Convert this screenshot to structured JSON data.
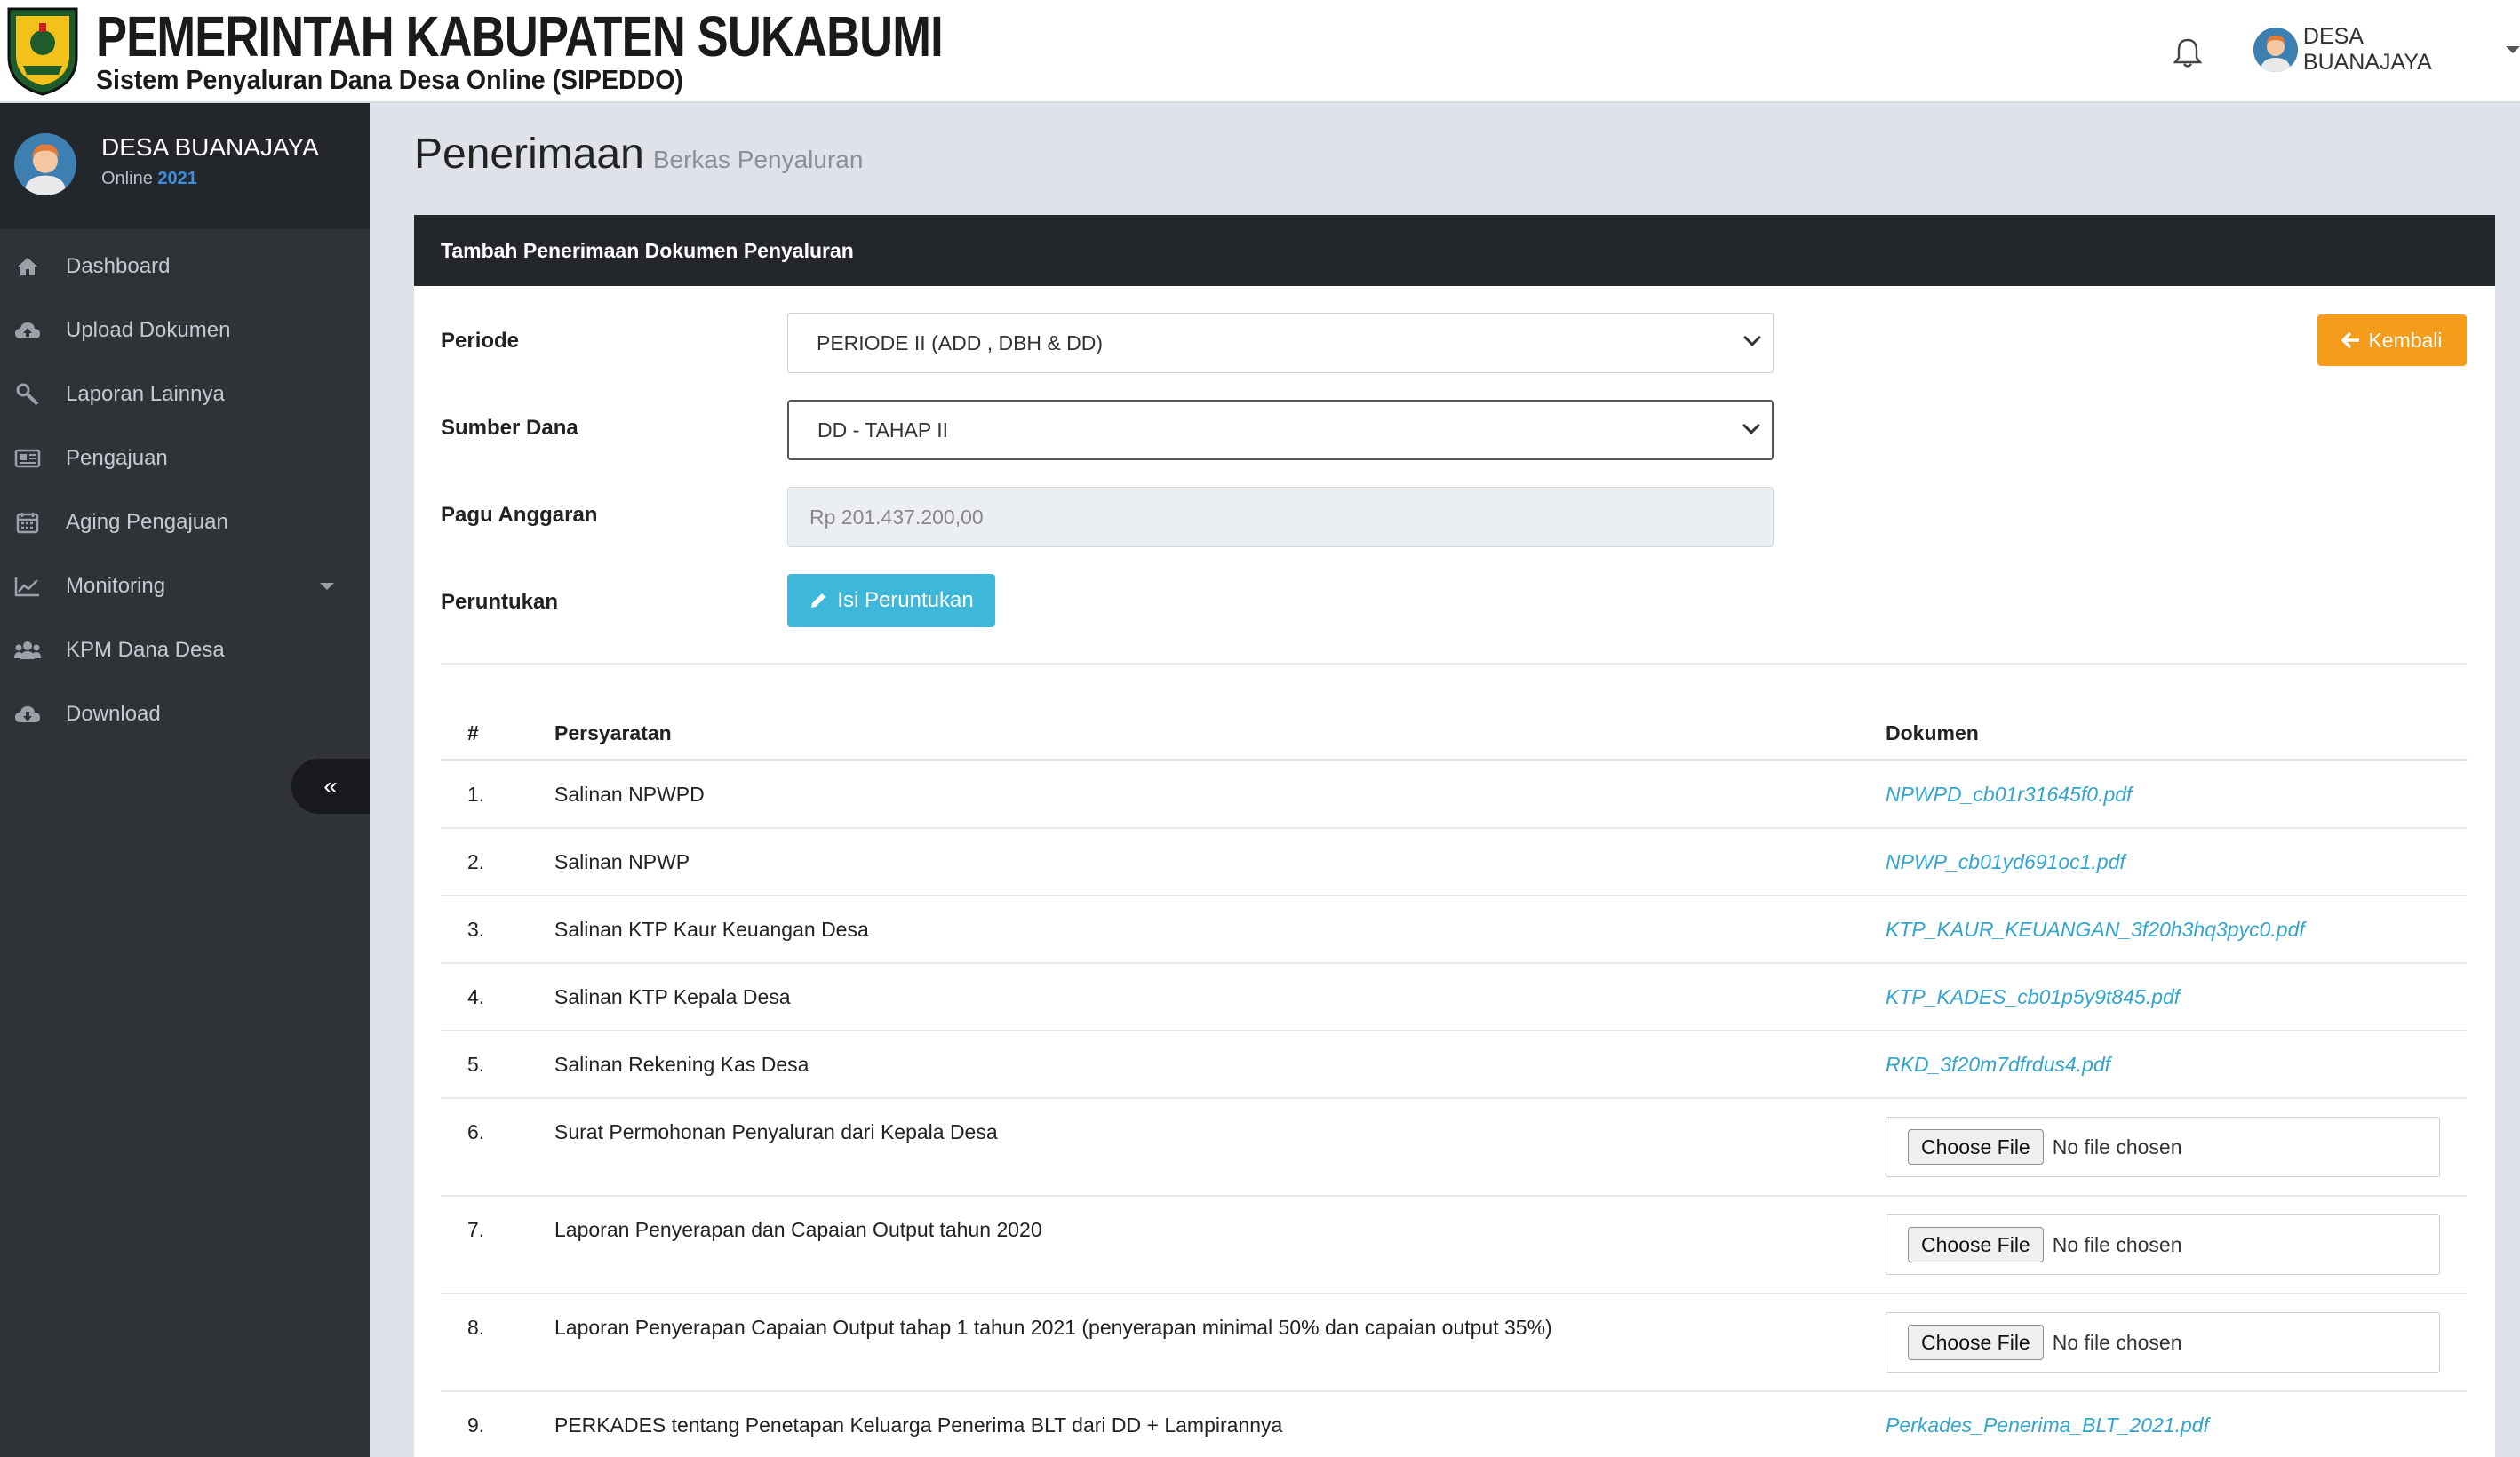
{
  "header": {
    "title": "PEMERINTAH KABUPATEN SUKABUMI",
    "subtitle": "Sistem Penyaluran Dana Desa Online (SIPEDDO)",
    "user_name": "DESA BUANAJAYA"
  },
  "sidebar": {
    "user_name": "DESA BUANAJAYA",
    "status_prefix": "Online",
    "status_year": "2021",
    "items": [
      {
        "label": "Dashboard",
        "icon": "home-icon"
      },
      {
        "label": "Upload Dokumen",
        "icon": "cloud-upload-icon"
      },
      {
        "label": "Laporan Lainnya",
        "icon": "wrench-icon"
      },
      {
        "label": "Pengajuan",
        "icon": "newspaper-icon"
      },
      {
        "label": "Aging Pengajuan",
        "icon": "calendar-icon"
      },
      {
        "label": "Monitoring",
        "icon": "line-chart-icon",
        "has_submenu": true
      },
      {
        "label": "KPM Dana Desa",
        "icon": "users-icon"
      },
      {
        "label": "Download",
        "icon": "cloud-download-icon"
      }
    ],
    "collapse_glyph": "«"
  },
  "page": {
    "title": "Penerimaan",
    "subtitle": "Berkas Penyaluran"
  },
  "card": {
    "title": "Tambah Penerimaan Dokumen Penyaluran",
    "back_button": "Kembali",
    "form": {
      "periode_label": "Periode",
      "periode_value": "PERIODE II (ADD , DBH & DD)",
      "sumber_label": "Sumber Dana",
      "sumber_value": "DD - TAHAP II",
      "pagu_label": "Pagu Anggaran",
      "pagu_value": "Rp 201.437.200,00",
      "peruntukan_label": "Peruntukan",
      "peruntukan_button": "Isi Peruntukan"
    },
    "table": {
      "headers": {
        "num": "#",
        "req": "Persyaratan",
        "doc": "Dokumen"
      },
      "file_button": "Choose File",
      "file_placeholder": "No file chosen",
      "rows": [
        {
          "num": "1.",
          "req": "Salinan NPWPD",
          "doc": "NPWPD_cb01r31645f0.pdf"
        },
        {
          "num": "2.",
          "req": "Salinan NPWP",
          "doc": "NPWP_cb01yd691oc1.pdf"
        },
        {
          "num": "3.",
          "req": "Salinan KTP Kaur Keuangan Desa",
          "doc": "KTP_KAUR_KEUANGAN_3f20h3hq3pyc0.pdf"
        },
        {
          "num": "4.",
          "req": "Salinan KTP Kepala Desa",
          "doc": "KTP_KADES_cb01p5y9t845.pdf"
        },
        {
          "num": "5.",
          "req": "Salinan Rekening Kas Desa",
          "doc": "RKD_3f20m7dfrdus4.pdf"
        },
        {
          "num": "6.",
          "req": "Surat Permohonan Penyaluran dari Kepala Desa",
          "doc": ""
        },
        {
          "num": "7.",
          "req": "Laporan Penyerapan dan Capaian Output tahun 2020",
          "doc": ""
        },
        {
          "num": "8.",
          "req": "Laporan Penyerapan Capaian Output tahap 1 tahun 2021 (penyerapan minimal 50% dan capaian output 35%)",
          "doc": ""
        },
        {
          "num": "9.",
          "req": "PERKADES tentang Penetapan Keluarga Penerima BLT dari DD + Lampirannya",
          "doc": "Perkades_Penerima_BLT_2021.pdf"
        }
      ]
    }
  },
  "colors": {
    "sidebar_bg": "#2f3338",
    "card_header_bg": "#23272b",
    "link": "#34a4cc",
    "info_button": "#3db8db",
    "warning_button": "#f59c1a",
    "year_highlight": "#3c8dde"
  }
}
